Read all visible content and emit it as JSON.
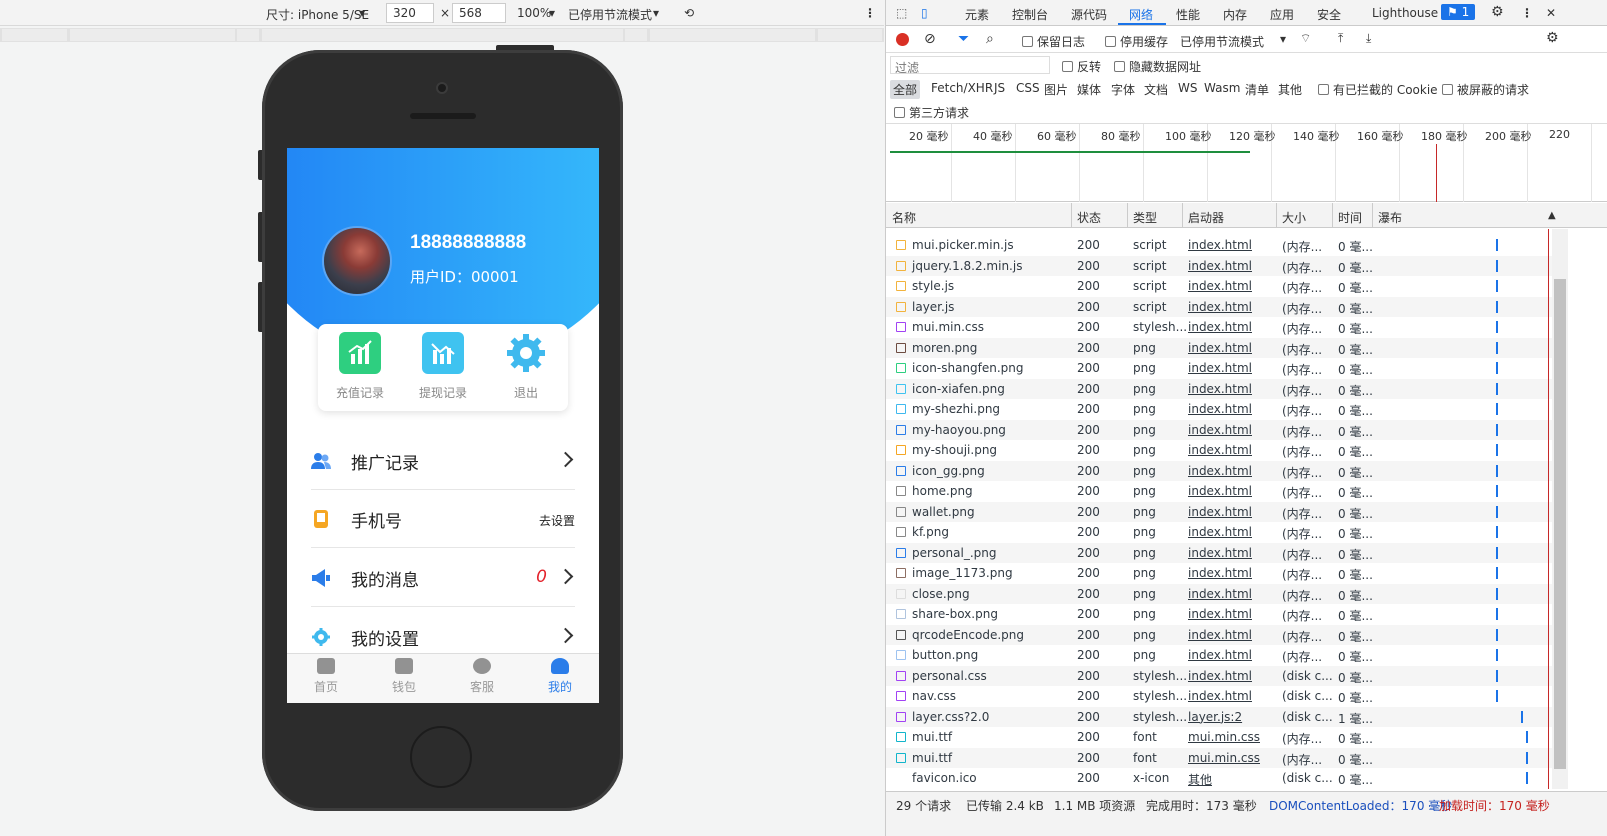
{
  "device_toolbar": {
    "size_label": "尺寸: iPhone 5/SE",
    "width": "320",
    "height": "568",
    "times": "×",
    "zoom": "100%",
    "throttle": "已停用节流模式"
  },
  "mobile": {
    "phone_number": "18888888888",
    "user_id": "用户ID：00001",
    "quick_actions": [
      {
        "label": "充值记录",
        "color": "#2ecf80"
      },
      {
        "label": "提现记录",
        "color": "#3fc3f0"
      },
      {
        "label": "退出",
        "color": "#3fb9ee"
      }
    ],
    "menu": [
      {
        "label": "推广记录",
        "extra": "",
        "count": ""
      },
      {
        "label": "手机号",
        "extra": "去设置",
        "count": ""
      },
      {
        "label": "我的消息",
        "extra": "",
        "count": "0"
      },
      {
        "label": "我的设置",
        "extra": "",
        "count": ""
      }
    ],
    "tabs": [
      {
        "label": "首页"
      },
      {
        "label": "钱包"
      },
      {
        "label": "客服"
      },
      {
        "label": "我的"
      }
    ]
  },
  "devtools": {
    "tabs": [
      "元素",
      "控制台",
      "源代码",
      "网络",
      "性能",
      "内存",
      "应用",
      "安全",
      "Lighthouse"
    ],
    "active_tab": "网络",
    "issues": "1",
    "preserve_log": "保留日志",
    "disable_cache": "停用缓存",
    "throttle": "已停用节流模式",
    "filter_placeholder": "过滤",
    "invert": "反转",
    "hide_data_urls": "隐藏数据网址",
    "types": [
      "全部",
      "Fetch/XHR",
      "JS",
      "CSS",
      "图片",
      "媒体",
      "字体",
      "文档",
      "WS",
      "Wasm",
      "清单",
      "其他"
    ],
    "blocked_cookies": "有已拦截的 Cookie",
    "blocked_requests": "被屏蔽的请求",
    "third_party": "第三方请求",
    "timeline_ticks": [
      "20 毫秒",
      "40 毫秒",
      "60 毫秒",
      "80 毫秒",
      "100 毫秒",
      "120 毫秒",
      "140 毫秒",
      "160 毫秒",
      "180 毫秒",
      "200 毫秒",
      "220"
    ],
    "columns": [
      "名称",
      "状态",
      "类型",
      "启动器",
      "大小",
      "时间",
      "瀑布"
    ],
    "requests": [
      {
        "name": "mui.picker.min.js",
        "status": "200",
        "type": "script",
        "initiator": "index.html",
        "size": "(内存...",
        "time": "0 毫...",
        "color": "#f2b33d"
      },
      {
        "name": "jquery.1.8.2.min.js",
        "status": "200",
        "type": "script",
        "initiator": "index.html",
        "size": "(内存...",
        "time": "0 毫...",
        "color": "#f2b33d"
      },
      {
        "name": "style.js",
        "status": "200",
        "type": "script",
        "initiator": "index.html",
        "size": "(内存...",
        "time": "0 毫...",
        "color": "#f2b33d"
      },
      {
        "name": "layer.js",
        "status": "200",
        "type": "script",
        "initiator": "index.html",
        "size": "(内存...",
        "time": "0 毫...",
        "color": "#f2b33d"
      },
      {
        "name": "mui.min.css",
        "status": "200",
        "type": "stylesh...",
        "initiator": "index.html",
        "size": "(内存...",
        "time": "0 毫...",
        "color": "#a142f4"
      },
      {
        "name": "moren.png",
        "status": "200",
        "type": "png",
        "initiator": "index.html",
        "size": "(内存...",
        "time": "0 毫...",
        "color": "#6d4c41"
      },
      {
        "name": "icon-shangfen.png",
        "status": "200",
        "type": "png",
        "initiator": "index.html",
        "size": "(内存...",
        "time": "0 毫...",
        "color": "#2ecf80"
      },
      {
        "name": "icon-xiafen.png",
        "status": "200",
        "type": "png",
        "initiator": "index.html",
        "size": "(内存...",
        "time": "0 毫...",
        "color": "#3fc3f0"
      },
      {
        "name": "my-shezhi.png",
        "status": "200",
        "type": "png",
        "initiator": "index.html",
        "size": "(内存...",
        "time": "0 毫...",
        "color": "#3fb9ee"
      },
      {
        "name": "my-haoyou.png",
        "status": "200",
        "type": "png",
        "initiator": "index.html",
        "size": "(内存...",
        "time": "0 毫...",
        "color": "#2b7de9"
      },
      {
        "name": "my-shouji.png",
        "status": "200",
        "type": "png",
        "initiator": "index.html",
        "size": "(内存...",
        "time": "0 毫...",
        "color": "#f5a623"
      },
      {
        "name": "icon_gg.png",
        "status": "200",
        "type": "png",
        "initiator": "index.html",
        "size": "(内存...",
        "time": "0 毫...",
        "color": "#2b7de9"
      },
      {
        "name": "home.png",
        "status": "200",
        "type": "png",
        "initiator": "index.html",
        "size": "(内存...",
        "time": "0 毫...",
        "color": "#888888"
      },
      {
        "name": "wallet.png",
        "status": "200",
        "type": "png",
        "initiator": "index.html",
        "size": "(内存...",
        "time": "0 毫...",
        "color": "#888888"
      },
      {
        "name": "kf.png",
        "status": "200",
        "type": "png",
        "initiator": "index.html",
        "size": "(内存...",
        "time": "0 毫...",
        "color": "#888888"
      },
      {
        "name": "personal_.png",
        "status": "200",
        "type": "png",
        "initiator": "index.html",
        "size": "(内存...",
        "time": "0 毫...",
        "color": "#2b7de9"
      },
      {
        "name": "image_1173.png",
        "status": "200",
        "type": "png",
        "initiator": "index.html",
        "size": "(内存...",
        "time": "0 毫...",
        "color": "#8d6e63"
      },
      {
        "name": "close.png",
        "status": "200",
        "type": "png",
        "initiator": "index.html",
        "size": "(内存...",
        "time": "0 毫...",
        "color": "#dddddd"
      },
      {
        "name": "share-box.png",
        "status": "200",
        "type": "png",
        "initiator": "index.html",
        "size": "(内存...",
        "time": "0 毫...",
        "color": "#b0c4de"
      },
      {
        "name": "qrcodeEncode.png",
        "status": "200",
        "type": "png",
        "initiator": "index.html",
        "size": "(内存...",
        "time": "0 毫...",
        "color": "#555555"
      },
      {
        "name": "button.png",
        "status": "200",
        "type": "png",
        "initiator": "index.html",
        "size": "(内存...",
        "time": "0 毫...",
        "color": "#9ec3f0"
      },
      {
        "name": "personal.css",
        "status": "200",
        "type": "stylesh...",
        "initiator": "index.html",
        "size": "(disk c...",
        "time": "0 毫...",
        "color": "#a142f4"
      },
      {
        "name": "nav.css",
        "status": "200",
        "type": "stylesh...",
        "initiator": "index.html",
        "size": "(disk c...",
        "time": "0 毫...",
        "color": "#a142f4"
      },
      {
        "name": "layer.css?2.0",
        "status": "200",
        "type": "stylesh...",
        "initiator": "layer.js:2",
        "size": "(disk c...",
        "time": "1 毫...",
        "color": "#a142f4"
      },
      {
        "name": "mui.ttf",
        "status": "200",
        "type": "font",
        "initiator": "mui.min.css",
        "size": "(内存...",
        "time": "0 毫...",
        "color": "#12b5cb"
      },
      {
        "name": "mui.ttf",
        "status": "200",
        "type": "font",
        "initiator": "mui.min.css",
        "size": "(内存...",
        "time": "0 毫...",
        "color": "#12b5cb"
      },
      {
        "name": "favicon.ico",
        "status": "200",
        "type": "x-icon",
        "initiator": "其他",
        "size": "(disk c...",
        "time": "0 毫...",
        "color": "#ffffff"
      }
    ],
    "summary": {
      "requests": "29 个请求",
      "transferred": "已传输 2.4 kB",
      "resources": "1.1 MB 项资源",
      "finish": "完成用时：173 毫秒",
      "dcl": "DOMContentLoaded：170 毫秒",
      "load": "加载时间：170 毫秒"
    }
  }
}
